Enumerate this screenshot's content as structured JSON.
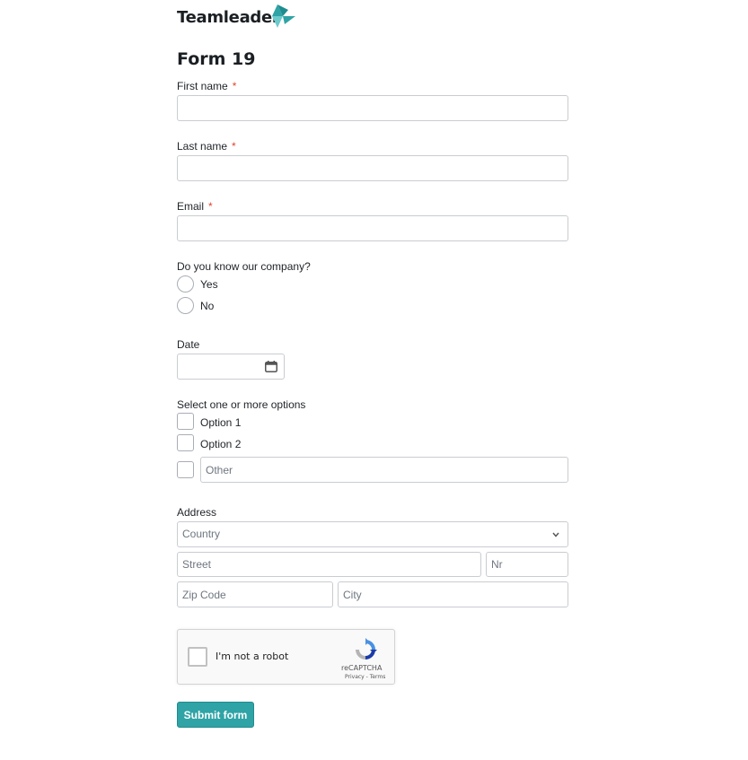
{
  "brand": {
    "name": "Teamleader",
    "accent": "#2fa3a6"
  },
  "form": {
    "title": "Form 19",
    "required_marker": "*",
    "first_name": {
      "label": "First name",
      "value": ""
    },
    "last_name": {
      "label": "Last name",
      "value": ""
    },
    "email": {
      "label": "Email",
      "value": ""
    },
    "know_company": {
      "label": "Do you know our company?",
      "options": [
        "Yes",
        "No"
      ]
    },
    "date": {
      "label": "Date",
      "value": "",
      "icon": "calendar-icon"
    },
    "multi_select": {
      "label": "Select one or more options",
      "options": [
        "Option 1",
        "Option 2"
      ],
      "other_placeholder": "Other"
    },
    "address": {
      "label": "Address",
      "country_placeholder": "Country",
      "street_placeholder": "Street",
      "nr_placeholder": "Nr",
      "zip_placeholder": "Zip Code",
      "city_placeholder": "City"
    },
    "captcha": {
      "text": "I'm not a robot",
      "brand": "reCAPTCHA",
      "links": "Privacy - Terms"
    },
    "submit_label": "Submit form"
  }
}
